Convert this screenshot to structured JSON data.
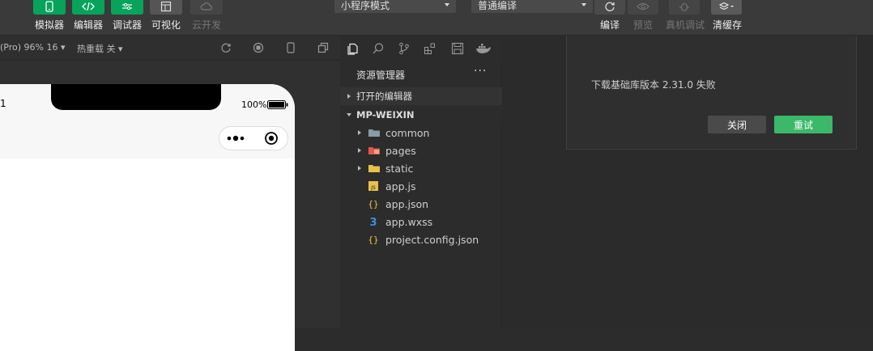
{
  "toolbar": {
    "buttons": [
      {
        "label": "模拟器",
        "icon": "phone-icon"
      },
      {
        "label": "编辑器",
        "icon": "code-icon"
      },
      {
        "label": "调试器",
        "icon": "sliders-icon"
      },
      {
        "label": "可视化",
        "icon": "layout-icon"
      },
      {
        "label": "云开发",
        "icon": "cloud-icon"
      }
    ],
    "mode_select": "小程序模式",
    "compile_select": "普通编译",
    "actions": [
      {
        "label": "编译",
        "icon": "refresh-icon"
      },
      {
        "label": "预览",
        "icon": "eye-icon"
      },
      {
        "label": "真机调试",
        "icon": "bug-icon"
      },
      {
        "label": "清缓存",
        "icon": "layers-icon"
      }
    ]
  },
  "simulator": {
    "device_label": "(Pro) 96% 16 ▾",
    "hot_reload_label": "热重载 关 ▾",
    "status_time": "1",
    "battery_text": "100%"
  },
  "explorer": {
    "title": "资源管理器",
    "more": "···",
    "open_editors": "打开的编辑器",
    "project_name": "MP-WEIXIN",
    "items": [
      {
        "name": "common",
        "type": "folder",
        "icon": "folder-icon",
        "color": "#8a9aa9"
      },
      {
        "name": "pages",
        "type": "folder",
        "icon": "pages-folder-icon",
        "color": "#e05b4b"
      },
      {
        "name": "static",
        "type": "folder",
        "icon": "folder-icon",
        "color": "#e8c04a"
      },
      {
        "name": "app.js",
        "type": "file",
        "icon": "js-file-icon",
        "color": "#e8c04a"
      },
      {
        "name": "app.json",
        "type": "file",
        "icon": "json-file-icon",
        "color": "#e8c04a"
      },
      {
        "name": "app.wxss",
        "type": "file",
        "icon": "css-file-icon",
        "color": "#3d8fe0"
      },
      {
        "name": "project.config.json",
        "type": "file",
        "icon": "json-file-icon",
        "color": "#e8c04a"
      }
    ]
  },
  "dialog": {
    "message": "下载基础库版本 2.31.0 失败",
    "close_label": "关闭",
    "retry_label": "重试"
  },
  "colors": {
    "accent": "#07a35a",
    "retry": "#3bb86a",
    "close": "#4a4a4a"
  }
}
